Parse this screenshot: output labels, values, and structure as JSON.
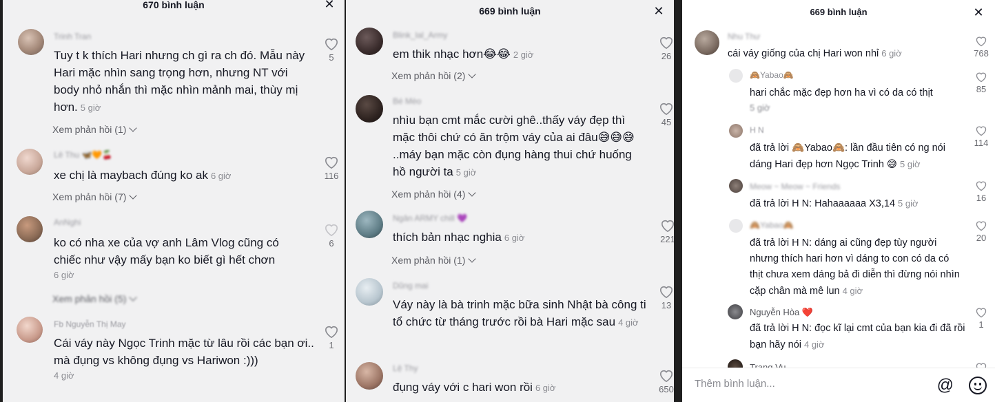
{
  "panel1": {
    "title": "670 bình luận",
    "comments": [
      {
        "user": "Trinh Tran",
        "text": "Tuy t k thích Hari nhưng ch gì ra ch đó. Mẫu này Hari mặc nhìn sang trọng hơn, nhưng NT với body nhỏ nhắn thì mặc nhìn mảnh mai, thùy mị hơn.",
        "time": "5 giờ",
        "likes": "5",
        "replies": "Xem phản hồi (1)"
      },
      {
        "user": "Lê Thu 🦋🧡🍒",
        "text": "xe chị là maybach đúng ko ak",
        "time": "6 giờ",
        "likes": "116",
        "replies": "Xem phản hồi (7)"
      },
      {
        "user": "AnNghi",
        "text": "ko có nha xe của vợ anh Lâm Vlog cũng có chiếc như vậy mấy bạn ko biết gì hết chơn",
        "time": "6 giờ",
        "likes": "6",
        "replies": "Xem phản hồi (5)"
      },
      {
        "user": "Fb Nguyễn Thị May",
        "text": "Cái váy này Ngọc Trinh mặc từ lâu rồi các bạn ơi.. mà đụng vs không đụng vs Hariwon :)))",
        "time": "4 giờ",
        "likes": "1"
      }
    ]
  },
  "panel2": {
    "title": "669 bình luận",
    "comments": [
      {
        "user": "Blink_lal_Army",
        "text": "em thik nhạc hơn😂😂",
        "time": "2 giờ",
        "likes": "26",
        "replies": "Xem phản hồi (2)"
      },
      {
        "user": "Bé Mèo",
        "text": "nhìu bạn cmt mắc cười ghê..thấy váy đẹp thì mặc thôi chứ có ăn trộm váy của ai đâu😅😅😅 ..máy bạn mặc còn đụng hàng thui chứ huống hồ người ta",
        "time": "5 giờ",
        "likes": "45",
        "replies": "Xem phản hồi (4)"
      },
      {
        "user": "Ngân ARMY chill 💜",
        "text": "thích bản nhạc nghia",
        "time": "6 giờ",
        "likes": "221",
        "replies": "Xem phản hồi (1)"
      },
      {
        "user": "Dũng mai",
        "text": "Váy này là bà trinh mặc bữa sinh Nhật bà công ti tổ chức từ tháng trước rồi bà Hari mặc sau",
        "time": "4 giờ",
        "likes": "13"
      },
      {
        "user": "Lệ Thy",
        "text": "đụng váy với c hari won rồi",
        "time": "6 giờ",
        "likes": "650"
      }
    ]
  },
  "panel3": {
    "title": "669 bình luận",
    "input_placeholder": "Thêm bình luận...",
    "comments": [
      {
        "user": "Nhu Thư",
        "text": "cái váy giống của chị Hari won nhỉ",
        "time": "6 giờ",
        "likes": "768"
      },
      {
        "user": "🙈Yabao🙈",
        "text": "hari chắc mặc đẹp hơn ha vì có da có thịt",
        "time": "5 giờ",
        "likes": "85"
      },
      {
        "user": "H N",
        "text": "đã trả lời 🙈Yabao🙈: lần đầu tiên có ng nói dáng Hari đẹp hơn Ngọc Trinh 😅",
        "time": "5 giờ",
        "likes": "114"
      },
      {
        "user": "Meow ~ Meow ~ Friends",
        "text": "đã trả lời H N: Hahaaaaaa X3,14",
        "time": "5 giờ",
        "likes": "16"
      },
      {
        "user": "🙈Yabao🙈",
        "text": "đã trả lời H N: dáng ai cũng đẹp tùy người nhưng thích hari hơn vì dáng to con có da có thịt chưa xem dáng bả đi diễn thì đừng nói nhìn cặp chân mà mê lun",
        "time": "4 giờ",
        "likes": "20"
      },
      {
        "user": "Nguyễn Hòa ❤️",
        "text": "đã trả lời H N: đọc kĩ lại cmt của bạn kia đi đã rồi bạn hãy nói",
        "time": "4 giờ",
        "likes": "1"
      },
      {
        "user": "Trang Vu",
        "likes": ""
      }
    ]
  },
  "icons": {
    "close": "close-icon",
    "heart": "heart-icon",
    "at": "at-icon",
    "emoji": "emoji-icon"
  }
}
